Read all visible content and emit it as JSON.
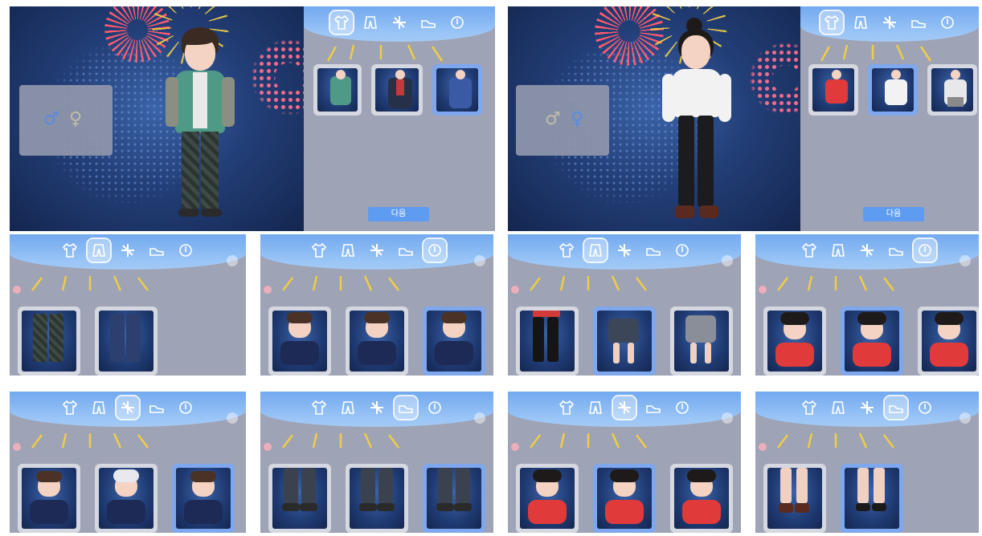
{
  "colors": {
    "scene_bg": "#233f78",
    "panel_bg": "#9ea3b5",
    "topbar": "#8ab8f3",
    "selected_frame": "#7ea7ee",
    "unselected_frame": "#d5d8e0",
    "next_button": "#5d9cf0",
    "ray_yellow": "#f0cd46"
  },
  "category_icons": [
    "shirt-icon",
    "pants-icon",
    "hair-icon",
    "shoes-icon",
    "face-icon"
  ],
  "screens": {
    "male_main": {
      "next_label": "다음",
      "selected_category": "shirt"
    },
    "female_main": {
      "next_label": "다음",
      "selected_category": "shirt"
    }
  }
}
